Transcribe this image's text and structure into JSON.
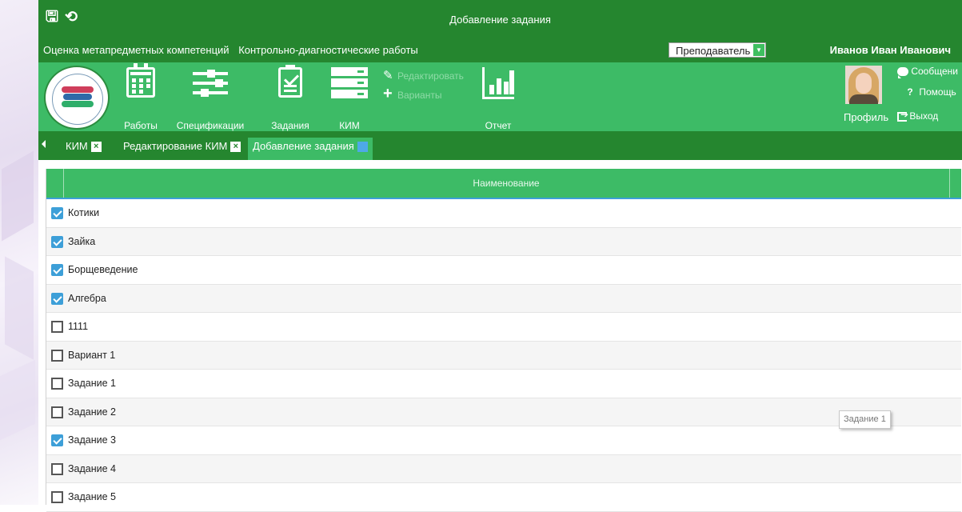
{
  "window": {
    "title": "Добавление задания"
  },
  "nav": {
    "link1": "Оценка метапредметных компетенций",
    "link2": "Контрольно-диагностические работы"
  },
  "role": {
    "selected": "Преподаватель"
  },
  "user": {
    "name": "Иванов Иван Иванович"
  },
  "ribbon": {
    "works": "Работы",
    "specifications": "Спецификации",
    "tasks": "Задания",
    "kim": "КИМ",
    "edit": "Редактировать",
    "variants": "Варианты",
    "report": "Отчет",
    "profile": "Профиль",
    "messages": "Сообщени",
    "help": "Помощь",
    "logout": "Выход"
  },
  "tabs": [
    {
      "label": "КИМ"
    },
    {
      "label": "Редактирование КИМ"
    },
    {
      "label": "Добавление задания"
    }
  ],
  "grid": {
    "header": "Наименование",
    "rows": [
      {
        "name": "Котики",
        "checked": true
      },
      {
        "name": "Зайка",
        "checked": true
      },
      {
        "name": "Борщеведение",
        "checked": true
      },
      {
        "name": "Алгебра",
        "checked": true
      },
      {
        "name": "1111",
        "checked": false
      },
      {
        "name": "Вариант 1",
        "checked": false
      },
      {
        "name": "Задание 1",
        "checked": false
      },
      {
        "name": "Задание 2",
        "checked": false
      },
      {
        "name": "Задание 3",
        "checked": true
      },
      {
        "name": "Задание 4",
        "checked": false
      },
      {
        "name": "Задание 5",
        "checked": false
      }
    ]
  },
  "tooltip": {
    "text": "Задание 1"
  },
  "colors": {
    "dark_green": "#25862f",
    "green": "#3dbb66",
    "accent_blue": "#3d9fd8"
  },
  "icons": [
    "save-icon",
    "undo-icon",
    "calendar-icon",
    "sliders-icon",
    "document-check-icon",
    "server-icon",
    "pencil-icon",
    "plus-icon",
    "bar-chart-icon",
    "chat-icon",
    "question-icon",
    "exit-icon",
    "close-icon",
    "checkbox-icon"
  ]
}
